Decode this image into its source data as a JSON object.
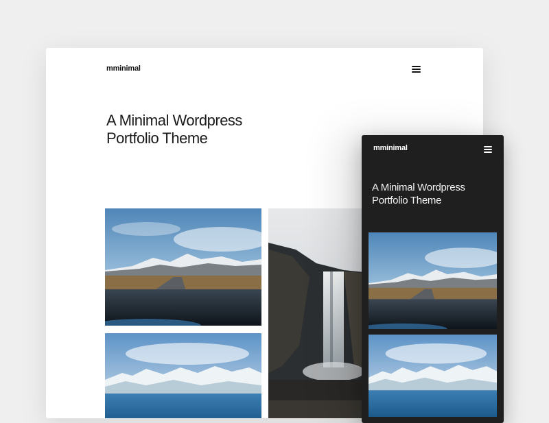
{
  "desktop": {
    "logo": "mminimal",
    "menu_icon": "hamburger-menu-icon",
    "title_line1": "A Minimal Wordpress",
    "title_line2": "Portfolio Theme"
  },
  "mobile": {
    "logo": "mminimal",
    "menu_icon": "hamburger-menu-icon",
    "title_line1": "A Minimal Wordpress",
    "title_line2": "Portfolio Theme"
  },
  "colors": {
    "page_background": "#efefef",
    "desktop_background": "#ffffff",
    "mobile_background": "#1f1f1f",
    "text_dark": "#1a1a1a",
    "text_light": "#f2f2f2"
  }
}
